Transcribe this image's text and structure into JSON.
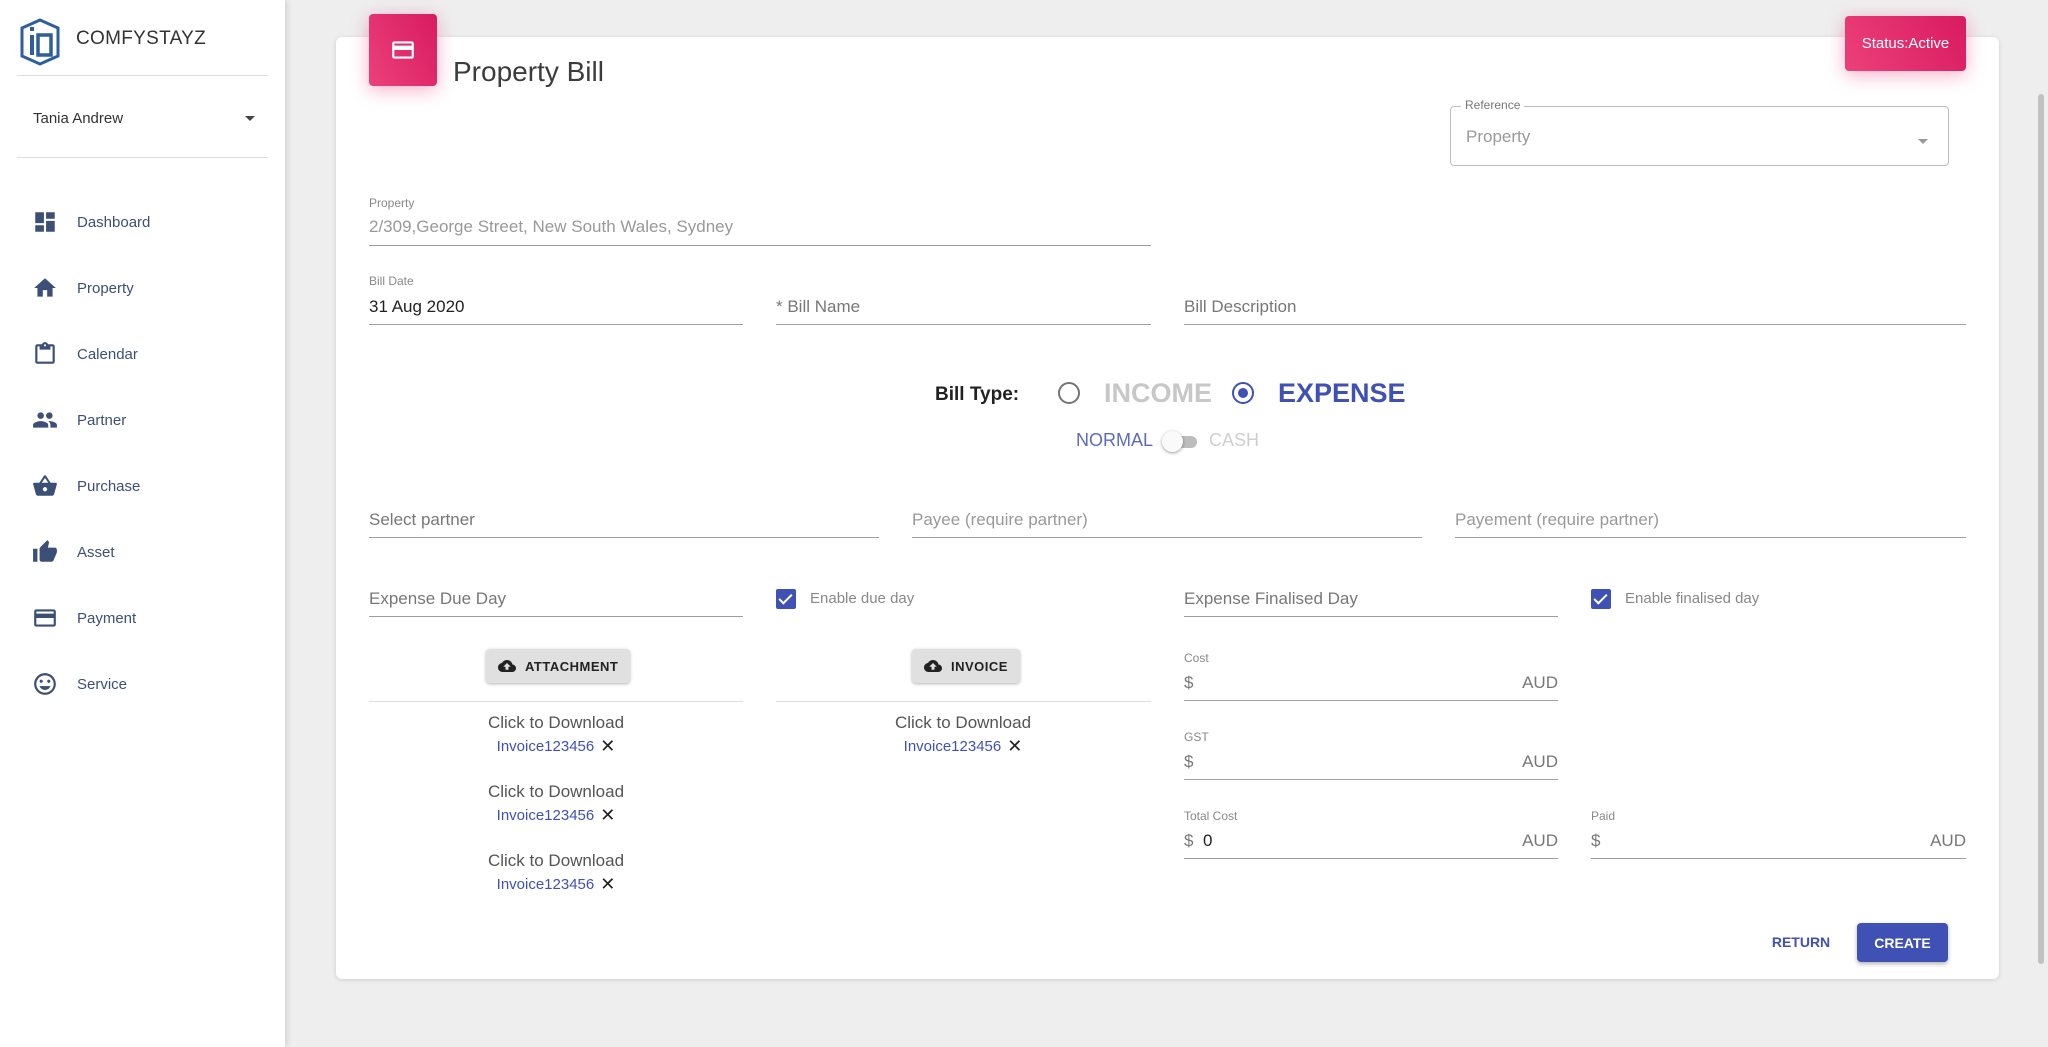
{
  "sidebar": {
    "brand": "COMFYSTAYZ",
    "user": "Tania Andrew",
    "items": [
      {
        "label": "Dashboard",
        "icon": "dashboard-icon"
      },
      {
        "label": "Property",
        "icon": "home-icon"
      },
      {
        "label": "Calendar",
        "icon": "clipboard-icon"
      },
      {
        "label": "Partner",
        "icon": "people-icon"
      },
      {
        "label": "Purchase",
        "icon": "basket-icon"
      },
      {
        "label": "Asset",
        "icon": "thumb-up-icon"
      },
      {
        "label": "Payment",
        "icon": "credit-card-icon"
      },
      {
        "label": "Service",
        "icon": "smiley-icon"
      }
    ]
  },
  "page": {
    "title": "Property Bill",
    "status": "Status:Active"
  },
  "reference": {
    "label": "Reference",
    "value": "Property"
  },
  "property": {
    "label": "Property",
    "value": "2/309,George Street, New South Wales, Sydney"
  },
  "bill_date": {
    "label": "Bill Date",
    "value": "31 Aug 2020"
  },
  "bill_name": {
    "placeholder": "* Bill Name"
  },
  "bill_description": {
    "placeholder": "Bill Description"
  },
  "bill_type": {
    "label": "Bill Type:",
    "options": [
      "INCOME",
      "EXPENSE"
    ],
    "selected": "EXPENSE",
    "mode_left": "NORMAL",
    "mode_right": "CASH"
  },
  "partner": {
    "placeholder": "Select partner"
  },
  "payee": {
    "placeholder": "Payee (require partner)"
  },
  "payment": {
    "placeholder": "Payement (require partner)"
  },
  "due_day": {
    "placeholder": "Expense Due Day",
    "checkbox_label": "Enable due day"
  },
  "finalised_day": {
    "placeholder": "Expense Finalised Day",
    "checkbox_label": "Enable finalised day"
  },
  "attachment": {
    "button": "ATTACHMENT",
    "files": [
      {
        "text": "Click to Download",
        "link": "Invoice123456"
      },
      {
        "text": "Click to Download",
        "link": "Invoice123456"
      },
      {
        "text": "Click to Download",
        "link": "Invoice123456"
      }
    ]
  },
  "invoice": {
    "button": "INVOICE",
    "files": [
      {
        "text": "Click to Download",
        "link": "Invoice123456"
      }
    ]
  },
  "cost": {
    "label": "Cost",
    "prefix": "$",
    "value": "",
    "suffix": "AUD"
  },
  "gst": {
    "label": "GST",
    "prefix": "$",
    "value": "",
    "suffix": "AUD"
  },
  "total_cost": {
    "label": "Total Cost",
    "prefix": "$",
    "value": "0",
    "suffix": "AUD"
  },
  "paid": {
    "label": "Paid",
    "prefix": "$",
    "value": "",
    "suffix": "AUD"
  },
  "actions": {
    "return": "RETURN",
    "create": "CREATE"
  },
  "colors": {
    "accent": "#3f51b5",
    "pink": "#e91e63",
    "nav": "#3c4f76"
  }
}
